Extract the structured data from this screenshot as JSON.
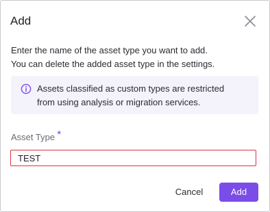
{
  "dialog": {
    "title": "Add",
    "close_icon": "close-icon",
    "description": [
      "Enter the name of the asset type you want to add.",
      "You can delete the added asset type in the settings."
    ],
    "info": {
      "icon": "info-icon",
      "lines": [
        "Assets classified as custom types are restricted",
        "from using analysis or migration services."
      ]
    },
    "field": {
      "label": "Asset Type",
      "required_marker": "*",
      "value": "TEST"
    },
    "buttons": {
      "cancel_label": "Cancel",
      "add_label": "Add"
    }
  },
  "colors": {
    "accent": "#7a4de8",
    "error_border": "#d9343f",
    "info_background": "#f4f2fb"
  }
}
